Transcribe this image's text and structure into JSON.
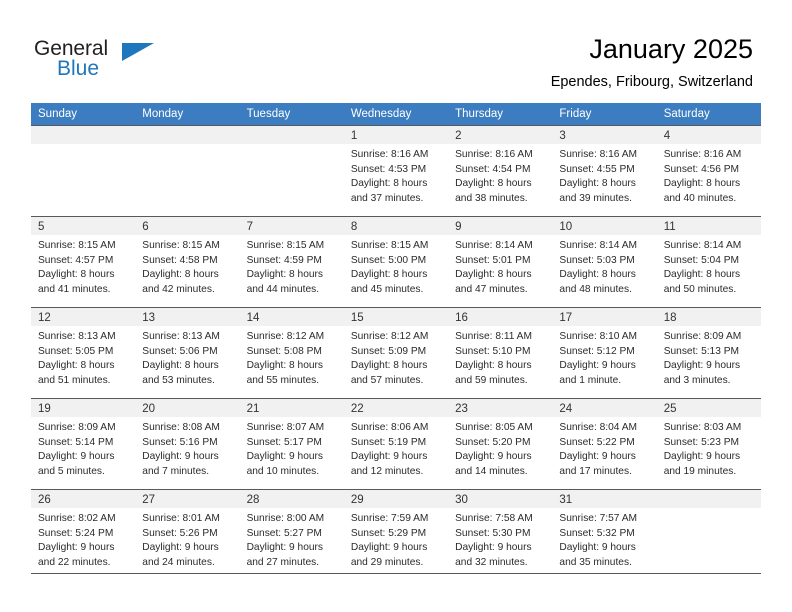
{
  "brand": {
    "name_top": "General",
    "name_bottom": "Blue"
  },
  "header": {
    "title": "January 2025",
    "location": "Ependes, Fribourg, Switzerland"
  },
  "weekdays": [
    "Sunday",
    "Monday",
    "Tuesday",
    "Wednesday",
    "Thursday",
    "Friday",
    "Saturday"
  ],
  "colors": {
    "header_band": "#3b7dc0",
    "daynum_band": "#f1f1f1",
    "grid_line": "#58595b",
    "brand_blue": "#1e76bd",
    "text": "#000000"
  },
  "weeks": [
    [
      {
        "day": "",
        "empty": true
      },
      {
        "day": "",
        "empty": true
      },
      {
        "day": "",
        "empty": true
      },
      {
        "day": "1",
        "sunrise": "Sunrise: 8:16 AM",
        "sunset": "Sunset: 4:53 PM",
        "daylight1": "Daylight: 8 hours",
        "daylight2": "and 37 minutes."
      },
      {
        "day": "2",
        "sunrise": "Sunrise: 8:16 AM",
        "sunset": "Sunset: 4:54 PM",
        "daylight1": "Daylight: 8 hours",
        "daylight2": "and 38 minutes."
      },
      {
        "day": "3",
        "sunrise": "Sunrise: 8:16 AM",
        "sunset": "Sunset: 4:55 PM",
        "daylight1": "Daylight: 8 hours",
        "daylight2": "and 39 minutes."
      },
      {
        "day": "4",
        "sunrise": "Sunrise: 8:16 AM",
        "sunset": "Sunset: 4:56 PM",
        "daylight1": "Daylight: 8 hours",
        "daylight2": "and 40 minutes."
      }
    ],
    [
      {
        "day": "5",
        "sunrise": "Sunrise: 8:15 AM",
        "sunset": "Sunset: 4:57 PM",
        "daylight1": "Daylight: 8 hours",
        "daylight2": "and 41 minutes."
      },
      {
        "day": "6",
        "sunrise": "Sunrise: 8:15 AM",
        "sunset": "Sunset: 4:58 PM",
        "daylight1": "Daylight: 8 hours",
        "daylight2": "and 42 minutes."
      },
      {
        "day": "7",
        "sunrise": "Sunrise: 8:15 AM",
        "sunset": "Sunset: 4:59 PM",
        "daylight1": "Daylight: 8 hours",
        "daylight2": "and 44 minutes."
      },
      {
        "day": "8",
        "sunrise": "Sunrise: 8:15 AM",
        "sunset": "Sunset: 5:00 PM",
        "daylight1": "Daylight: 8 hours",
        "daylight2": "and 45 minutes."
      },
      {
        "day": "9",
        "sunrise": "Sunrise: 8:14 AM",
        "sunset": "Sunset: 5:01 PM",
        "daylight1": "Daylight: 8 hours",
        "daylight2": "and 47 minutes."
      },
      {
        "day": "10",
        "sunrise": "Sunrise: 8:14 AM",
        "sunset": "Sunset: 5:03 PM",
        "daylight1": "Daylight: 8 hours",
        "daylight2": "and 48 minutes."
      },
      {
        "day": "11",
        "sunrise": "Sunrise: 8:14 AM",
        "sunset": "Sunset: 5:04 PM",
        "daylight1": "Daylight: 8 hours",
        "daylight2": "and 50 minutes."
      }
    ],
    [
      {
        "day": "12",
        "sunrise": "Sunrise: 8:13 AM",
        "sunset": "Sunset: 5:05 PM",
        "daylight1": "Daylight: 8 hours",
        "daylight2": "and 51 minutes."
      },
      {
        "day": "13",
        "sunrise": "Sunrise: 8:13 AM",
        "sunset": "Sunset: 5:06 PM",
        "daylight1": "Daylight: 8 hours",
        "daylight2": "and 53 minutes."
      },
      {
        "day": "14",
        "sunrise": "Sunrise: 8:12 AM",
        "sunset": "Sunset: 5:08 PM",
        "daylight1": "Daylight: 8 hours",
        "daylight2": "and 55 minutes."
      },
      {
        "day": "15",
        "sunrise": "Sunrise: 8:12 AM",
        "sunset": "Sunset: 5:09 PM",
        "daylight1": "Daylight: 8 hours",
        "daylight2": "and 57 minutes."
      },
      {
        "day": "16",
        "sunrise": "Sunrise: 8:11 AM",
        "sunset": "Sunset: 5:10 PM",
        "daylight1": "Daylight: 8 hours",
        "daylight2": "and 59 minutes."
      },
      {
        "day": "17",
        "sunrise": "Sunrise: 8:10 AM",
        "sunset": "Sunset: 5:12 PM",
        "daylight1": "Daylight: 9 hours",
        "daylight2": "and 1 minute."
      },
      {
        "day": "18",
        "sunrise": "Sunrise: 8:09 AM",
        "sunset": "Sunset: 5:13 PM",
        "daylight1": "Daylight: 9 hours",
        "daylight2": "and 3 minutes."
      }
    ],
    [
      {
        "day": "19",
        "sunrise": "Sunrise: 8:09 AM",
        "sunset": "Sunset: 5:14 PM",
        "daylight1": "Daylight: 9 hours",
        "daylight2": "and 5 minutes."
      },
      {
        "day": "20",
        "sunrise": "Sunrise: 8:08 AM",
        "sunset": "Sunset: 5:16 PM",
        "daylight1": "Daylight: 9 hours",
        "daylight2": "and 7 minutes."
      },
      {
        "day": "21",
        "sunrise": "Sunrise: 8:07 AM",
        "sunset": "Sunset: 5:17 PM",
        "daylight1": "Daylight: 9 hours",
        "daylight2": "and 10 minutes."
      },
      {
        "day": "22",
        "sunrise": "Sunrise: 8:06 AM",
        "sunset": "Sunset: 5:19 PM",
        "daylight1": "Daylight: 9 hours",
        "daylight2": "and 12 minutes."
      },
      {
        "day": "23",
        "sunrise": "Sunrise: 8:05 AM",
        "sunset": "Sunset: 5:20 PM",
        "daylight1": "Daylight: 9 hours",
        "daylight2": "and 14 minutes."
      },
      {
        "day": "24",
        "sunrise": "Sunrise: 8:04 AM",
        "sunset": "Sunset: 5:22 PM",
        "daylight1": "Daylight: 9 hours",
        "daylight2": "and 17 minutes."
      },
      {
        "day": "25",
        "sunrise": "Sunrise: 8:03 AM",
        "sunset": "Sunset: 5:23 PM",
        "daylight1": "Daylight: 9 hours",
        "daylight2": "and 19 minutes."
      }
    ],
    [
      {
        "day": "26",
        "sunrise": "Sunrise: 8:02 AM",
        "sunset": "Sunset: 5:24 PM",
        "daylight1": "Daylight: 9 hours",
        "daylight2": "and 22 minutes."
      },
      {
        "day": "27",
        "sunrise": "Sunrise: 8:01 AM",
        "sunset": "Sunset: 5:26 PM",
        "daylight1": "Daylight: 9 hours",
        "daylight2": "and 24 minutes."
      },
      {
        "day": "28",
        "sunrise": "Sunrise: 8:00 AM",
        "sunset": "Sunset: 5:27 PM",
        "daylight1": "Daylight: 9 hours",
        "daylight2": "and 27 minutes."
      },
      {
        "day": "29",
        "sunrise": "Sunrise: 7:59 AM",
        "sunset": "Sunset: 5:29 PM",
        "daylight1": "Daylight: 9 hours",
        "daylight2": "and 29 minutes."
      },
      {
        "day": "30",
        "sunrise": "Sunrise: 7:58 AM",
        "sunset": "Sunset: 5:30 PM",
        "daylight1": "Daylight: 9 hours",
        "daylight2": "and 32 minutes."
      },
      {
        "day": "31",
        "sunrise": "Sunrise: 7:57 AM",
        "sunset": "Sunset: 5:32 PM",
        "daylight1": "Daylight: 9 hours",
        "daylight2": "and 35 minutes."
      },
      {
        "day": "",
        "empty": true
      }
    ]
  ]
}
